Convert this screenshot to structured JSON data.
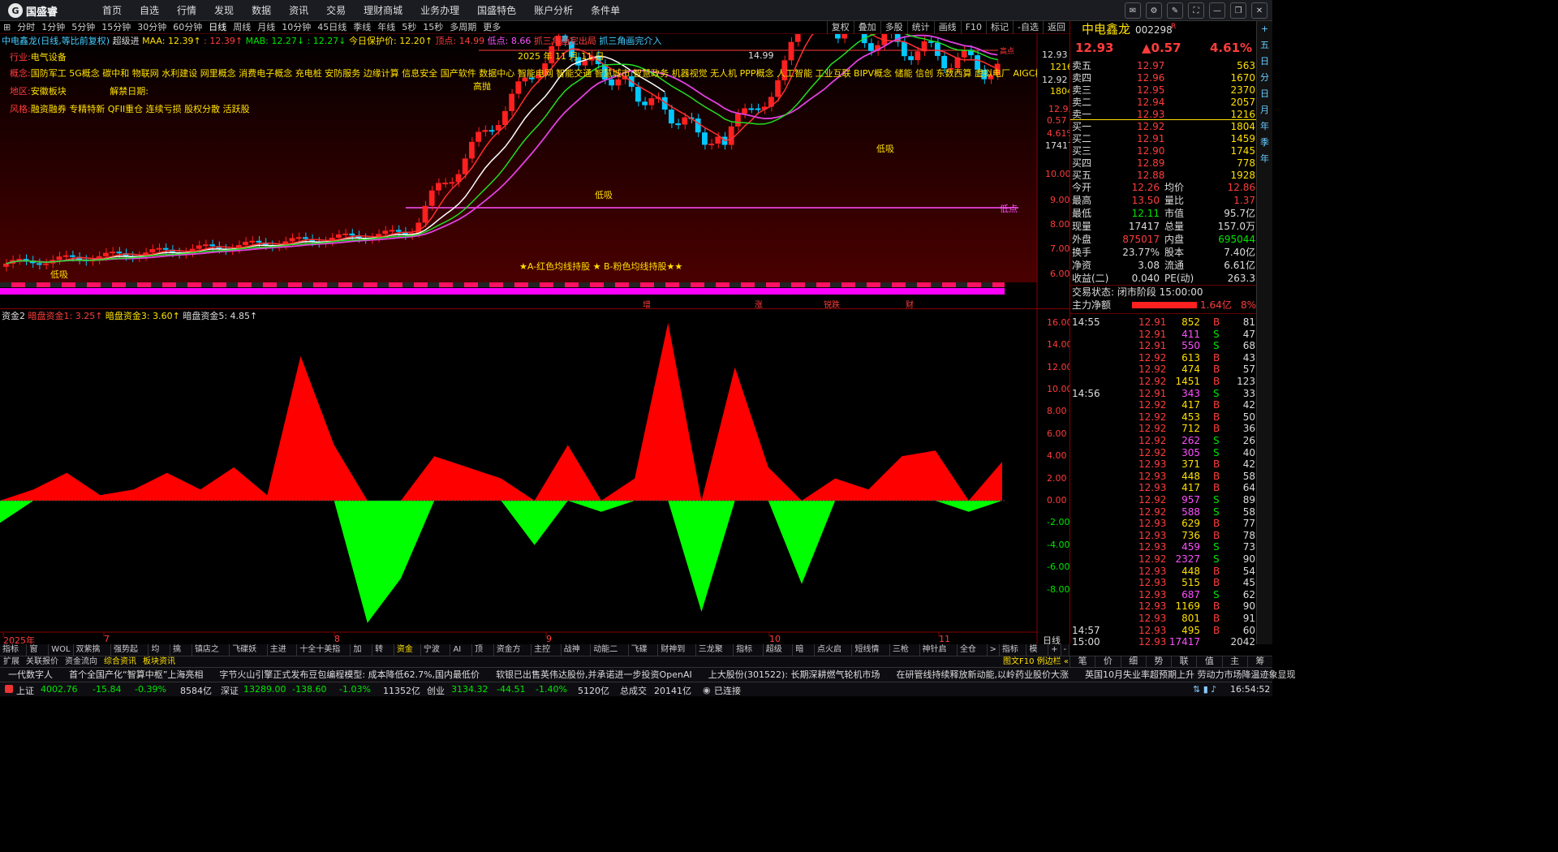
{
  "app": {
    "logo": "国盛睿",
    "logo_mark": "G"
  },
  "menu": [
    "首页",
    "自选",
    "行情",
    "发现",
    "数据",
    "资讯",
    "交易",
    "理财商城",
    "业务办理",
    "国盛特色",
    "账户分析",
    "条件单"
  ],
  "window_controls": [
    "message-icon",
    "settings-icon",
    "skin-icon",
    "fullscreen-icon",
    "minimize-icon",
    "restore-icon",
    "close-icon"
  ],
  "periods": [
    "分时",
    "1分钟",
    "5分钟",
    "15分钟",
    "30分钟",
    "60分钟",
    "日线",
    "周线",
    "月线",
    "10分钟",
    "45日线",
    "季线",
    "年线",
    "5秒",
    "15秒",
    "多周期",
    "更多"
  ],
  "active_period": "日线",
  "right_tools": [
    "复权",
    "叠加",
    "多股",
    "统计",
    "画线",
    "F10",
    "标记",
    "-自选",
    "返回"
  ],
  "chart_header": {
    "name": "中电鑫龙(日线,等比前复权)",
    "extra": "超级进",
    "maa": "MAA: 12.39↑",
    "maa2": ": 12.39↑",
    "mab": "MAB: 12.27↓",
    "mab2": ": 12.27↓",
    "protect": "今日保护价: 12.20↑",
    "peak": "顶点: 14.99",
    "low": "低点: 8.66",
    "cross1": "抓三角画完出局",
    "cross2": "抓三角画完介入"
  },
  "info": {
    "industry_label": "行业:",
    "industry": "电气设备",
    "concept_label": "概念:",
    "concepts": "国防军工 5G概念 碳中和 物联网 水利建设 网里概念 消费电子概念 充电桩 安防服务 边缘计算 信息安全 国产软件 数据中心 智能电网 智能交通 智慧城市 智慧政务 机器视觉 无人机 PPP概念 人工智能 工业互联 BIPV概念 储能 信创 东数西算 虚拟电厂 AIGC概念 数据要素 B",
    "region_label": "地区:",
    "region": "安徽板块",
    "unlock_label": "解禁日期:",
    "style_label": "风格:",
    "style": "融资融券 专精特新 QFII重仓 连续亏损 股权分散 活跃股",
    "date": "2025 年 11 月 11 日",
    "legend": "★A-红色均线持股 ★ B-粉色均线持股★★",
    "tags": [
      "高抛",
      "低吸",
      "低吸",
      "低吸",
      "14.99",
      "低点",
      "高点"
    ],
    "bottom_signals": [
      "增",
      "涨",
      "锐跌",
      "财"
    ]
  },
  "lower_header": {
    "name": "资金2",
    "a": "暗盘资金1: 3.25↑",
    "b": "暗盘资金3: 3.60↑",
    "c": "暗盘资金5: 4.85↑"
  },
  "price_axis": [
    "12.93",
    "1216",
    "12.92",
    "1804",
    "0.57",
    "12.93",
    "4.61%",
    "17417",
    "10.00",
    "9.00",
    "8.00",
    "7.00",
    "6.00"
  ],
  "lower_axis": [
    "16.00",
    "14.00",
    "12.00",
    "10.00",
    "8.00",
    "6.00",
    "4.00",
    "2.00",
    "0.00",
    "-2.00",
    "-4.00",
    "-6.00",
    "-8.00"
  ],
  "date_axis": [
    "2025年",
    "7",
    "8",
    "9",
    "10",
    "11"
  ],
  "quote": {
    "name": "中电鑫龙",
    "code": "002298",
    "flag": "R",
    "price": "12.93",
    "change": "▲0.57",
    "pct": "4.61%",
    "asks": [
      [
        "卖五",
        "12.97",
        "563"
      ],
      [
        "卖四",
        "12.96",
        "1670"
      ],
      [
        "卖三",
        "12.95",
        "2370"
      ],
      [
        "卖二",
        "12.94",
        "2057"
      ],
      [
        "卖一",
        "12.93",
        "1216"
      ]
    ],
    "bids": [
      [
        "买一",
        "12.92",
        "1804"
      ],
      [
        "买二",
        "12.91",
        "1459"
      ],
      [
        "买三",
        "12.90",
        "1745"
      ],
      [
        "买四",
        "12.89",
        "778"
      ],
      [
        "买五",
        "12.88",
        "1928"
      ]
    ],
    "stats": [
      [
        "今开",
        "12.26",
        "均价",
        "12.86"
      ],
      [
        "最高",
        "13.50",
        "量比",
        "1.37"
      ],
      [
        "最低",
        "12.11",
        "市值",
        "95.7亿"
      ],
      [
        "现量",
        "17417",
        "总量",
        "157.0万"
      ],
      [
        "外盘",
        "875017",
        "内盘",
        "695044"
      ],
      [
        "换手",
        "23.77%",
        "股本",
        "7.40亿"
      ],
      [
        "净资",
        "3.08",
        "流通",
        "6.61亿"
      ],
      [
        "收益(二)",
        "0.040",
        "PE(动)",
        "263.3"
      ]
    ],
    "trade_state": "交易状态: 闭市阶段 15:00:00",
    "main_flow_label": "主力净额",
    "main_flow": "1.64亿",
    "main_flow_pct": "8%"
  },
  "ticks": [
    [
      "14:55",
      "12.91",
      "852",
      "B",
      "81"
    ],
    [
      "",
      "12.91",
      "411",
      "S",
      "47"
    ],
    [
      "",
      "12.91",
      "550",
      "S",
      "68"
    ],
    [
      "",
      "12.92",
      "613",
      "B",
      "43"
    ],
    [
      "",
      "12.92",
      "474",
      "B",
      "57"
    ],
    [
      "",
      "12.92",
      "1451",
      "B",
      "123"
    ],
    [
      "14:56",
      "12.91",
      "343",
      "S",
      "33"
    ],
    [
      "",
      "12.92",
      "417",
      "B",
      "42"
    ],
    [
      "",
      "12.92",
      "453",
      "B",
      "50"
    ],
    [
      "",
      "12.92",
      "712",
      "B",
      "36"
    ],
    [
      "",
      "12.92",
      "262",
      "S",
      "26"
    ],
    [
      "",
      "12.92",
      "305",
      "S",
      "40"
    ],
    [
      "",
      "12.93",
      "371",
      "B",
      "42"
    ],
    [
      "",
      "12.93",
      "448",
      "B",
      "58"
    ],
    [
      "",
      "12.93",
      "417",
      "B",
      "64"
    ],
    [
      "",
      "12.92",
      "957",
      "S",
      "89"
    ],
    [
      "",
      "12.92",
      "588",
      "S",
      "58"
    ],
    [
      "",
      "12.93",
      "629",
      "B",
      "77"
    ],
    [
      "",
      "12.93",
      "736",
      "B",
      "78"
    ],
    [
      "",
      "12.93",
      "459",
      "S",
      "73"
    ],
    [
      "",
      "12.92",
      "2327",
      "S",
      "90"
    ],
    [
      "",
      "12.93",
      "448",
      "B",
      "54"
    ],
    [
      "",
      "12.93",
      "515",
      "B",
      "45"
    ],
    [
      "",
      "12.93",
      "687",
      "S",
      "62"
    ],
    [
      "",
      "12.93",
      "1169",
      "B",
      "90"
    ],
    [
      "",
      "12.93",
      "801",
      "B",
      "91"
    ],
    [
      "14:57",
      "12.93",
      "495",
      "B",
      "60"
    ],
    [
      "15:00",
      "12.93",
      "17417",
      "",
      "2042"
    ]
  ],
  "side_tabs": [
    "+",
    "五",
    "日",
    "分",
    "日",
    "月",
    "年",
    "季",
    "年"
  ],
  "tabs1": [
    "指标A",
    "窗口",
    "WOL",
    "双紫擒龙",
    "强势起爆",
    "均线",
    "擒龙",
    "镇店之宝",
    "飞碟妖龙",
    "主进出",
    "十全十美指标",
    "加仓",
    "转点",
    "资金2",
    "宁波敢",
    "AI龙",
    "顶底",
    "资金方向",
    "主控盘",
    "战神号",
    "动能二号",
    "飞碟妖",
    "财神到家",
    "三龙聚首",
    "指标王",
    "超级进",
    "暗盘",
    "点火启动",
    "短线情绪",
    "三枪买",
    "神针启动",
    "全仓买",
    ">",
    "指标B",
    "模板",
    "+",
    "-"
  ],
  "active_tab1": "资金2",
  "tabs2": [
    "扩展",
    "关联报价",
    "资金流向",
    "综合资讯",
    "板块资讯"
  ],
  "tabs2_right": "图文F10 例边栏 «",
  "rptabs": [
    "笔",
    "价",
    "细",
    "势",
    "联",
    "值",
    "主",
    "筹"
  ],
  "news": [
    "一代数字人",
    "首个全国产化“智算中枢”上海亮相",
    "字节火山引擎正式发布豆包编程模型: 成本降低62.7%,国内最低价",
    "软银已出售英伟达股份,并承诺进一步投资OpenAI",
    "上大股份(301522): 长期深耕燃气轮机市场",
    "在研管线持续释放新动能,以岭药业股价大涨",
    "英国10月失业率超预期上升 劳动力市场降温迹象显现"
  ],
  "status": {
    "sh_label": "上证",
    "sh": "4002.76",
    "sh_chg": "-15.84",
    "sh_pct": "-0.39%",
    "sh_amt": "8584亿",
    "sz_label": "深证",
    "sz": "13289.00",
    "sz_chg": "-138.60",
    "sz_pct": "-1.03%",
    "sz_amt": "11352亿",
    "cy_label": "创业",
    "cy": "3134.32",
    "cy_chg": "-44.51",
    "cy_pct": "-1.40%",
    "cy_amt": "5120亿",
    "total_label": "总成交",
    "total": "20141亿",
    "conn": "已连接",
    "time": "16:54:52"
  },
  "colors": {
    "up": "#ff3c3c",
    "down": "#00e600",
    "mag": "#ff50ff",
    "yellow": "#ffe000",
    "bg": "#000000"
  },
  "chart_data": {
    "type": "bar",
    "title": "资金2",
    "x": [
      "2025-06-16",
      "2025-07-01",
      "2025-07-15",
      "2025-08-01",
      "2025-08-15",
      "2025-09-01",
      "2025-09-15",
      "2025-10-01",
      "2025-10-15",
      "2025-11-01",
      "2025-11-14"
    ],
    "series": [
      {
        "name": "资金2",
        "values": [
          -2,
          1,
          2.5,
          0.5,
          1,
          2.5,
          1,
          3,
          0.5,
          13,
          5,
          -11,
          -7,
          4,
          3,
          2,
          -4,
          5,
          -1,
          2,
          16,
          -10,
          12,
          3,
          -7.5,
          2,
          1,
          4,
          4.5,
          -1,
          3.5
        ]
      }
    ],
    "ylim": [
      -10,
      16
    ],
    "price_series": {
      "name": "中电鑫龙",
      "high": 14.99,
      "low": 8.66,
      "close": 12.93
    }
  }
}
